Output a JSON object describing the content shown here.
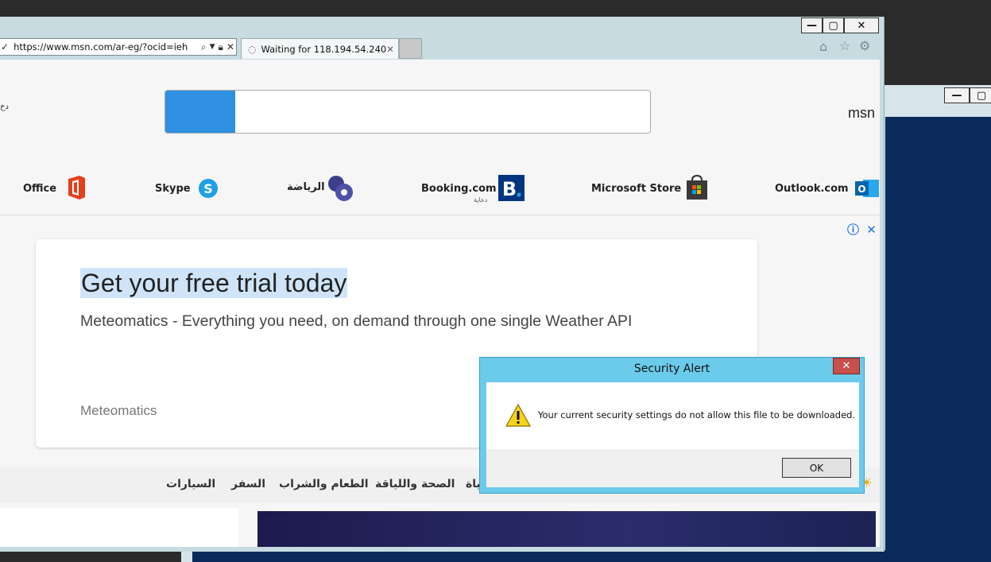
{
  "browser": {
    "url": "https://www.msn.com/ar-eg/?ocid=ieh",
    "tab_title": "Waiting for 118.194.54.240",
    "window_controls": {
      "minimize": "—",
      "maximize": "▢",
      "close": "✕"
    }
  },
  "page": {
    "brand": "msn",
    "left_edge_text": "دخ",
    "quick_links": [
      {
        "label": "Office"
      },
      {
        "label": "Skype"
      },
      {
        "label": "الرياضة"
      },
      {
        "label": "Booking.com",
        "sub": "دعاية"
      },
      {
        "label": "Microsoft Store"
      },
      {
        "label": "Outlook.com"
      }
    ],
    "ad": {
      "title": "Get your free trial today",
      "subtitle": "Meteomatics - Everything you need, on demand through one single Weather API",
      "brand": "Meteomatics",
      "info_icon": "ⓘ",
      "close_icon": "✕"
    },
    "nav": [
      "السيارات",
      "السفر",
      "الطعام والشراب",
      "الصحة واللياقة",
      "ياة"
    ]
  },
  "dialog": {
    "title": "Security Alert",
    "close": "✕",
    "message": "Your current security settings do not allow this file to be downloaded.",
    "ok_label": "OK"
  },
  "colors": {
    "dialog_frame": "#6ccbeb",
    "accent_blue": "#2f8fe0",
    "close_red": "#c7504a"
  }
}
